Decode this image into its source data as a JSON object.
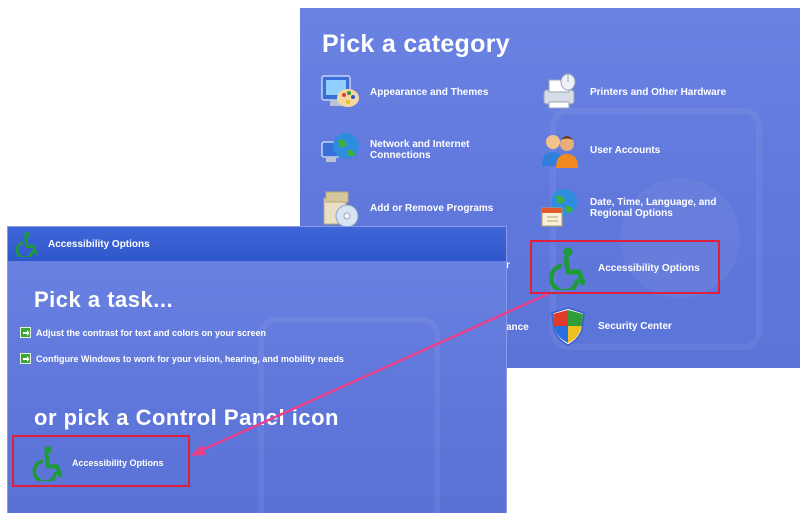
{
  "category_window": {
    "title": "Pick a category",
    "items": [
      {
        "label": "Appearance and Themes",
        "icon": "appearance-themes-icon"
      },
      {
        "label": "Printers and Other Hardware",
        "icon": "printer-icon"
      },
      {
        "label": "Network and Internet Connections",
        "icon": "network-globe-icon"
      },
      {
        "label": "User Accounts",
        "icon": "user-accounts-icon"
      },
      {
        "label": "Add or Remove Programs",
        "icon": "add-remove-programs-icon"
      },
      {
        "label": "Date, Time, Language, and Regional Options",
        "icon": "date-time-globe-icon"
      },
      {
        "label": "Accessibility Options",
        "icon": "wheelchair-icon"
      },
      {
        "label": "Security Center",
        "icon": "security-shield-icon"
      }
    ],
    "partial_texts": [
      "r",
      "ance"
    ]
  },
  "task_window": {
    "titlebar": "Accessibility Options",
    "pick_task_title": "Pick a task...",
    "tasks": [
      "Adjust the contrast for text and colors on your screen",
      "Configure Windows to work for your vision, hearing, and mobility needs"
    ],
    "cp_title": "or pick a Control Panel icon",
    "cp_item": "Accessibility Options"
  },
  "colors": {
    "xp_blue": "#6078dc",
    "title_blue": "#2f58cc",
    "highlight_red": "#e0203a",
    "arrow_pink": "#e8408a",
    "wheelchair_green": "#1f9a3a"
  }
}
